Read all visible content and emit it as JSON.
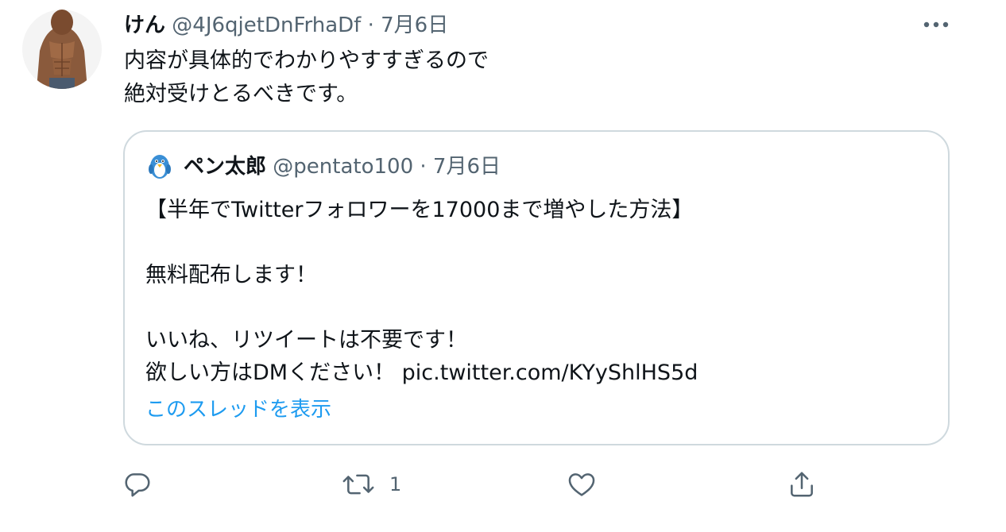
{
  "tweet": {
    "author": {
      "display_name": "けん",
      "handle": "@4J6qjetDnFrhaDf",
      "date": "7月6日",
      "separator": "·"
    },
    "text_lines": [
      "内容が具体的でわかりやすすぎるので",
      "絶対受けとるべきです。"
    ],
    "more_icon": "more-horizontal-icon"
  },
  "quoted_tweet": {
    "author": {
      "display_name": "ペン太郎",
      "handle": "@pentato100",
      "date": "7月6日",
      "separator": "·"
    },
    "lines": [
      "【半年でTwitterフォロワーを17000まで増やした方法】",
      "",
      "無料配布します！",
      "",
      "いいね、リツイートは不要です！",
      "欲しい方はDMください！ pic.twitter.com/KYyShlHS5d"
    ],
    "show_thread_label": "このスレッドを表示"
  },
  "actions": {
    "reply_icon": "reply-icon",
    "retweet_icon": "retweet-icon",
    "retweet_count": "1",
    "like_icon": "heart-icon",
    "share_icon": "share-icon"
  },
  "colors": {
    "text": "#0f1419",
    "secondary": "#536471",
    "link": "#1d9bf0",
    "border": "#cfd9de"
  }
}
